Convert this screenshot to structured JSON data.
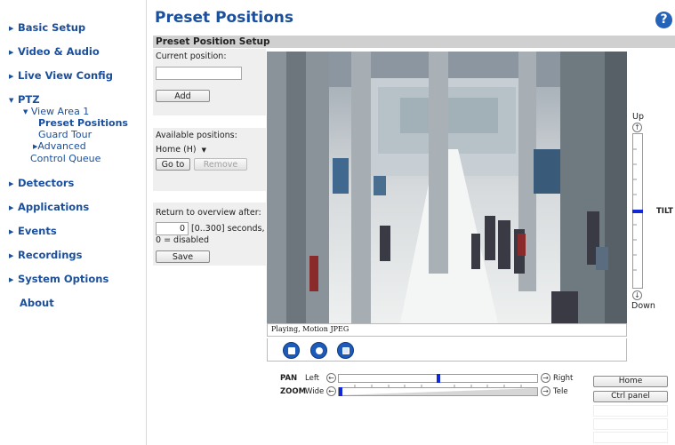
{
  "sidebar": {
    "basic_setup": "Basic Setup",
    "video_audio": "Video & Audio",
    "live_view_config": "Live View Config",
    "ptz": "PTZ",
    "view_area": "View Area 1",
    "preset_positions": "Preset Positions",
    "guard_tour": "Guard Tour",
    "advanced": "Advanced",
    "control_queue": "Control Queue",
    "detectors": "Detectors",
    "applications": "Applications",
    "events": "Events",
    "recordings": "Recordings",
    "system_options": "System Options",
    "about": "About"
  },
  "header": {
    "title": "Preset Positions",
    "help": "?",
    "section_title": "Preset Position Setup"
  },
  "current_position": {
    "label": "Current position:",
    "value": "",
    "add_label": "Add"
  },
  "available_positions": {
    "label": "Available positions:",
    "selected": "Home (H)",
    "goto_label": "Go to",
    "remove_label": "Remove"
  },
  "return_overview": {
    "label": "Return to overview after:",
    "value": "0",
    "range_text": "[0..300] seconds,",
    "disabled_text": "0 = disabled",
    "save_label": "Save"
  },
  "video": {
    "status": "Playing, Motion JPEG"
  },
  "tilt": {
    "up_label": "Up",
    "down_label": "Down",
    "label": "TILT",
    "up_arrow": "↑",
    "down_arrow": "↓",
    "position": 0.5
  },
  "pan": {
    "label": "PAN",
    "left_label": "Left",
    "right_label": "Right",
    "left_arrow": "←",
    "right_arrow": "→",
    "position": 0.5
  },
  "zoom": {
    "label": "ZOOM",
    "wide_label": "Wide",
    "tele_label": "Tele",
    "left_arrow": "←",
    "right_arrow": "→",
    "position": 0.0
  },
  "right_panel": {
    "home_label": "Home",
    "ctrl_panel_label": "Ctrl panel"
  },
  "colors": {
    "link": "#1b4f9c",
    "accent": "#1e5bb8",
    "section_bar": "#d0d0d0",
    "panel_bg": "#efefef"
  }
}
